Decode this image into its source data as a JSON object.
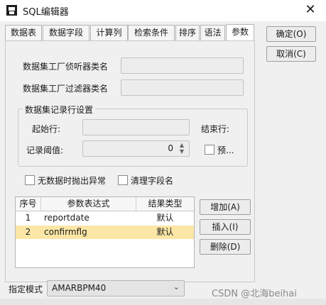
{
  "window": {
    "title": "SQL编辑器",
    "close_glyph": "✕"
  },
  "tabs": [
    {
      "label": "数据表"
    },
    {
      "label": "数据字段"
    },
    {
      "label": "计算列"
    },
    {
      "label": "检索条件"
    },
    {
      "label": "排序"
    },
    {
      "label": "语法"
    },
    {
      "label": "参数"
    }
  ],
  "buttons": {
    "ok": "确定(O)",
    "cancel": "取消(C)"
  },
  "form": {
    "listener_label": "数据集工厂侦听器类名",
    "filter_label": "数据集工厂过滤器类名",
    "record_group_label": "数据集记录行设置",
    "start_row_label": "起始行:",
    "end_row_label": "结束行:",
    "threshold_label": "记录阈值:",
    "threshold_value": "0",
    "preview_label": "预...",
    "no_data_exception_label": "无数据时抛出异常",
    "clear_fields_label": "清理字段名"
  },
  "table": {
    "columns": [
      "序号",
      "参数表达式",
      "结果类型"
    ],
    "rows": [
      {
        "index": "1",
        "expr": "reportdate",
        "type": "默认"
      },
      {
        "index": "2",
        "expr": "confirmflg",
        "type": "默认"
      }
    ]
  },
  "table_buttons": {
    "add": "增加(A)",
    "insert": "插入(I)",
    "delete": "删除(D)"
  },
  "mode": {
    "label": "指定模式",
    "value": "AMARBPM40"
  },
  "watermark": "CSDN @北海beihai",
  "colors": {
    "selected_row": "#fbe6a6",
    "window_bg": "#f0f0f0"
  }
}
